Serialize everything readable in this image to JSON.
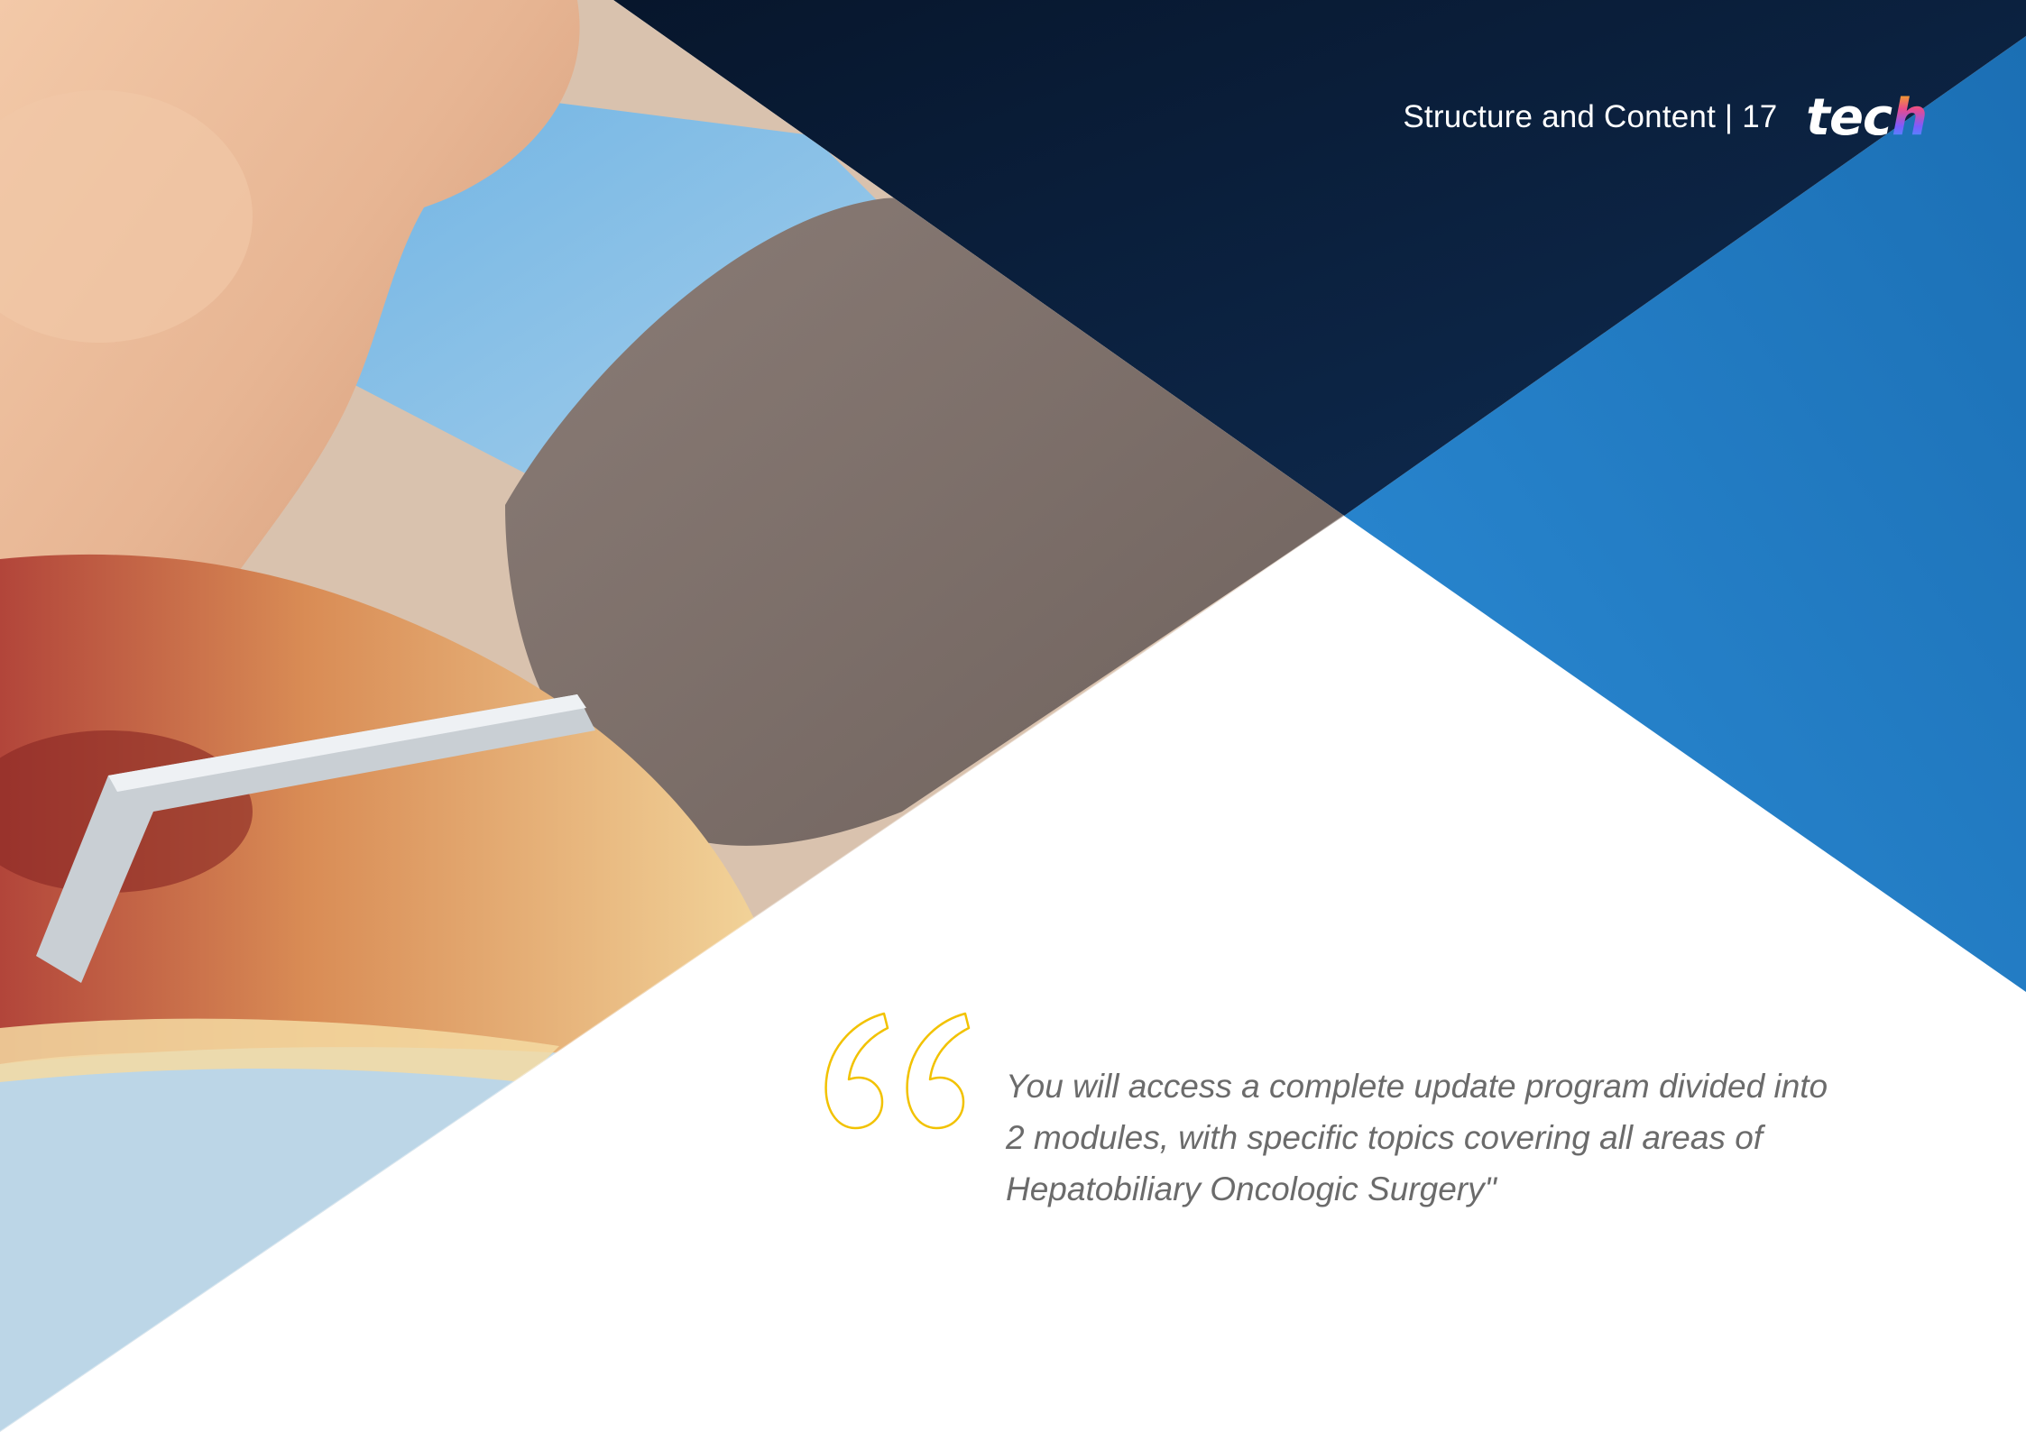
{
  "header": {
    "section_title": "Structure and Content |",
    "page_number": "17",
    "logo": {
      "text_main": "tec",
      "text_accent": "h"
    }
  },
  "quote": {
    "icon": "open-quote-icon",
    "text": "You will access a complete update program divided into 2 modules, with specific topics covering all areas of Hepatobiliary Oncologic Surgery\""
  },
  "colors": {
    "dark_navy": "#0b1f3a",
    "brand_blue": "#2480c8",
    "quote_yellow": "#f2c200",
    "body_text": "#6b6b6b"
  }
}
